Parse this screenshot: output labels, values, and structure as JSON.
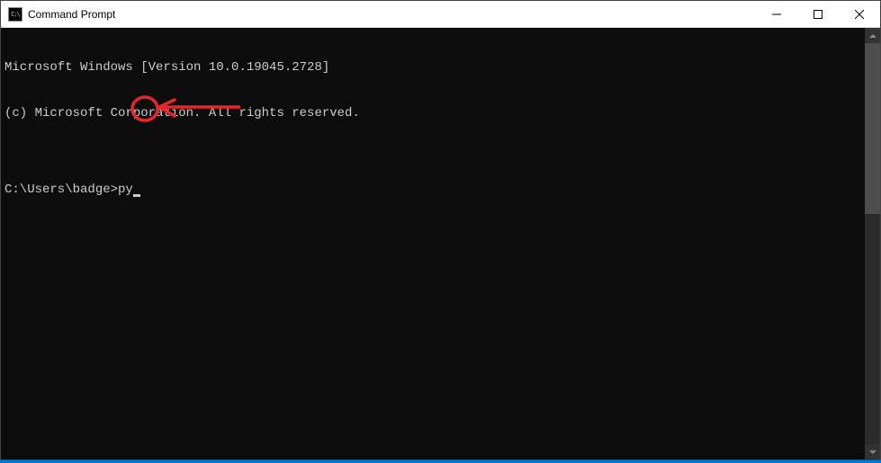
{
  "window": {
    "title": "Command Prompt"
  },
  "console": {
    "line1": "Microsoft Windows [Version 10.0.19045.2728]",
    "line2": "(c) Microsoft Corporation. All rights reserved.",
    "blank": "",
    "prompt": "C:\\Users\\badge>",
    "command": "py"
  }
}
